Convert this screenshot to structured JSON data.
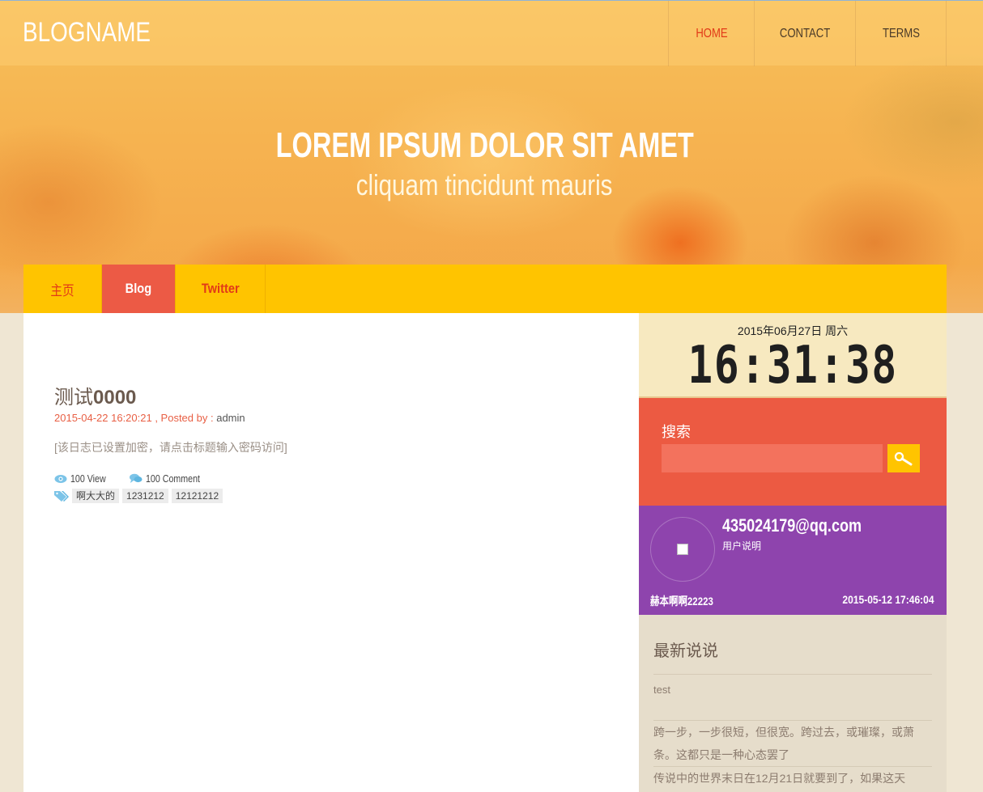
{
  "header": {
    "blogname": "BLOGNAME",
    "nav": [
      {
        "label": "HOME"
      },
      {
        "label": "CONTACT"
      },
      {
        "label": "TERMS"
      }
    ]
  },
  "hero": {
    "title": "LOREM IPSUM DOLOR SIT AMET",
    "subtitle": "cliquam tincidunt mauris"
  },
  "mainnav": {
    "items": [
      {
        "label": "主页"
      },
      {
        "label": "Blog"
      },
      {
        "label": "Twitter"
      }
    ]
  },
  "post": {
    "title_cn": "测试",
    "title_num": "0000",
    "meta_date": "2015-04-22 16:20:21 , Posted by :",
    "author": "admin",
    "excerpt": "[该日志已设置加密，请点击标题输入密码访问]",
    "views": "100 View",
    "comments": "100 Comment",
    "tags": [
      "啊大大的",
      "1231212",
      "12121212"
    ]
  },
  "clock": {
    "date": "2015年06月27日 周六",
    "time": "16:31:38"
  },
  "search": {
    "title": "搜索",
    "placeholder": ""
  },
  "user": {
    "email": "435024179@qq.com",
    "desc": "用户说明",
    "name": "赫本啊啊22223",
    "date": "2015-05-12 17:46:04"
  },
  "latest": {
    "title": "最新说说",
    "items": [
      "test",
      "跨一步，一步很短，但很宽。跨过去，或璀璨，或萧条。这都只是一种心态罢了",
      "传说中的世界末日在12月21日就要到了，如果这天"
    ]
  },
  "colors": {
    "accent_yellow": "#ffc400",
    "accent_red": "#ec5a42",
    "accent_purple": "#8e44ad"
  }
}
